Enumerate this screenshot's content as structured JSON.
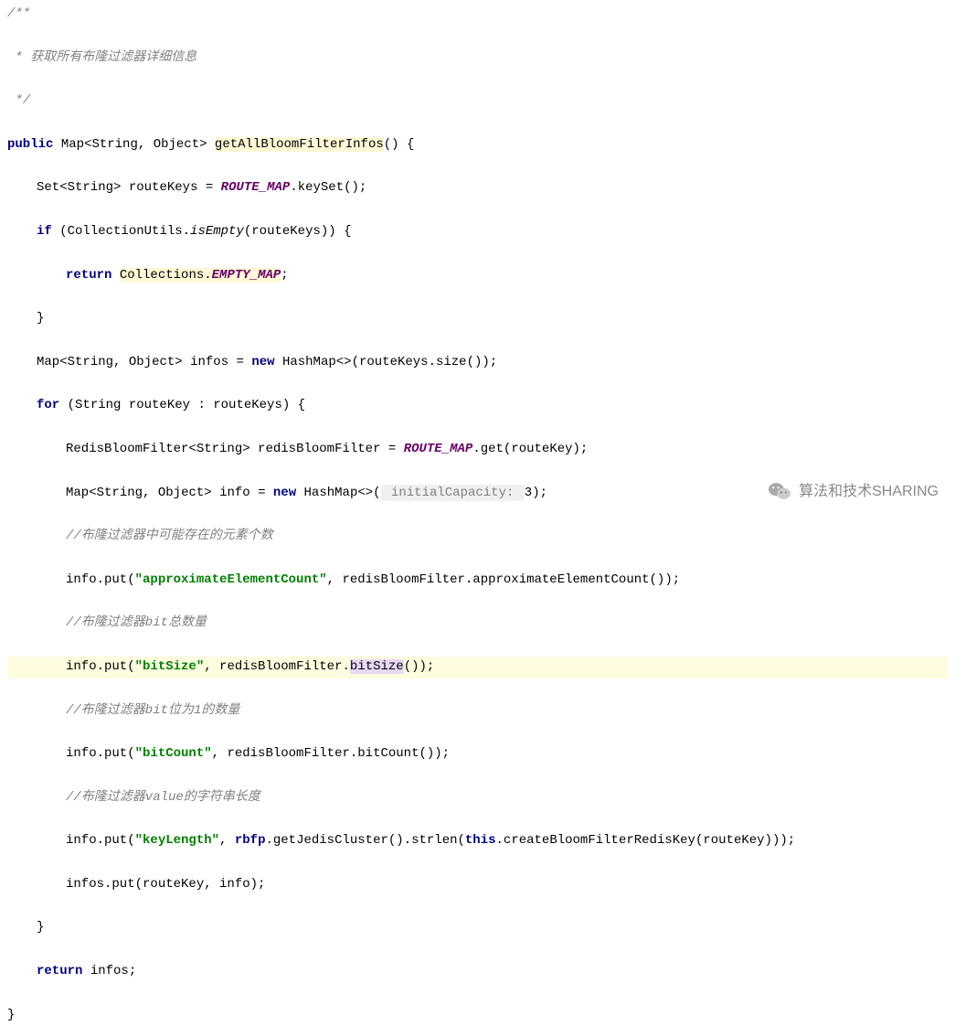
{
  "doc": {
    "open": "/**",
    "line1": " * 获取所有布隆过滤器详细信息",
    "close": " */"
  },
  "l4": {
    "public": "public",
    "map": "Map",
    "lt": "<",
    "string": "String",
    "comma": ", ",
    "object": "Object",
    "gt": ">",
    "sp": " ",
    "method": "getAllBloomFilterInfos",
    "paren": "()",
    "brace": " {"
  },
  "l5": {
    "set": "Set",
    "lt": "<",
    "string": "String",
    "gt": ">",
    "var": " routeKeys = ",
    "routemap": "ROUTE_MAP",
    "call": ".keySet();"
  },
  "l6": {
    "if": "if",
    "sp": " (",
    "cls": "CollectionUtils.",
    "m": "isEmpty",
    "args": "(routeKeys)) {"
  },
  "l7": {
    "return": "return",
    "sp": " ",
    "coll": "Collections.",
    "empty": "EMPTY_MAP",
    "semi": ";"
  },
  "l8": {
    "brace": "}"
  },
  "l9": {
    "map": "Map",
    "lt": "<",
    "string": "String",
    "comma": ", ",
    "object": "Object",
    "gt": ">",
    "var": " infos = ",
    "new": "new",
    "sp": " ",
    "hashmap": "HashMap",
    "diamond": "<>",
    "args": "(routeKeys.size());"
  },
  "l10": {
    "for": "for",
    "args": " (String routeKey : routeKeys) {"
  },
  "l11": {
    "type": "RedisBloomFilter",
    "lt": "<",
    "string": "String",
    "gt": ">",
    "var": " redisBloomFilter = ",
    "routemap": "ROUTE_MAP",
    "call": ".get(routeKey);"
  },
  "l12": {
    "map": "Map",
    "lt": "<",
    "string": "String",
    "comma": ", ",
    "object": "Object",
    "gt": ">",
    "var": " info = ",
    "new": "new",
    "sp": " ",
    "hashmap": "HashMap",
    "diamond": "<>",
    "open": "(",
    "hint": " initialCapacity: ",
    "val": "3",
    "close": ");"
  },
  "c13": "//布隆过滤器中可能存在的元素个数",
  "l14": {
    "pre": "info.put(",
    "str": "\"approximateElementCount\"",
    "post": ", redisBloomFilter.approximateElementCount());"
  },
  "c15": "//布隆过滤器bit总数量",
  "l16": {
    "pre": "info.put(",
    "str": "\"bitSize\"",
    "mid": ", redisBloomFilter.",
    "hl": "bitSize",
    "post": "());"
  },
  "c17": "//布隆过滤器bit位为1的数量",
  "l18": {
    "pre": "info.put(",
    "str": "\"bitCount\"",
    "post": ", redisBloomFilter.bitCount());"
  },
  "c19": "//布隆过滤器value的字符串长度",
  "l20": {
    "pre": "info.put(",
    "str": "\"keyLength\"",
    "mid": ", ",
    "rbfp": "rbfp",
    "call1": ".getJedisCluster().strlen(",
    "this": "this",
    "call2": ".createBloomFilterRedisKey(routeKey)));"
  },
  "l21": "infos.put(routeKey, info);",
  "l22": {
    "brace": "}"
  },
  "l23": {
    "return": "return",
    "rest": " infos;"
  },
  "l24": {
    "brace": "}"
  },
  "watermark": "算法和技术SHARING"
}
